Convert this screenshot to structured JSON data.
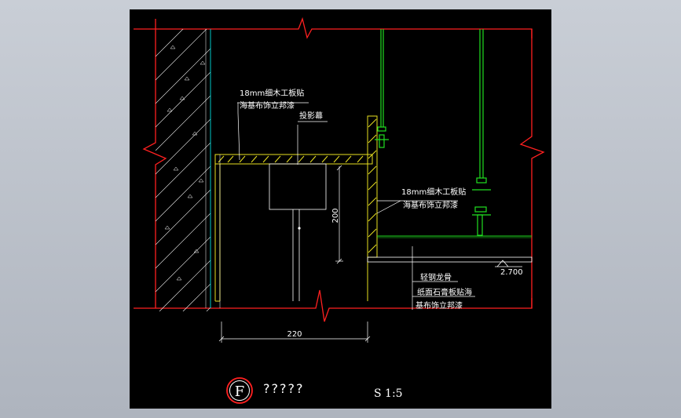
{
  "annotations": {
    "top_left_line1": "18mm细木工板贴",
    "top_left_line2": "海基布饰立邦漆",
    "screen": "投影幕",
    "right_line1": "18mm细木工板贴",
    "right_line2": "海基布饰立邦漆",
    "keel": "轻钢龙骨",
    "gypsum_line1": "纸面石膏板贴海",
    "gypsum_line2": "基布饰立邦漆"
  },
  "dimensions": {
    "vertical": "200",
    "horizontal": "220",
    "elevation": "2.700"
  },
  "title_block": {
    "symbol": "F",
    "title": "?????",
    "scale": "S 1:5"
  },
  "colors": {
    "background": "#000000",
    "break_line": "#ff2020",
    "wall_hatch": "#ffffff",
    "wall_edge": "#00c8c8",
    "board": "#e8e020",
    "suspension": "#20e020",
    "leader": "#ffffff"
  }
}
